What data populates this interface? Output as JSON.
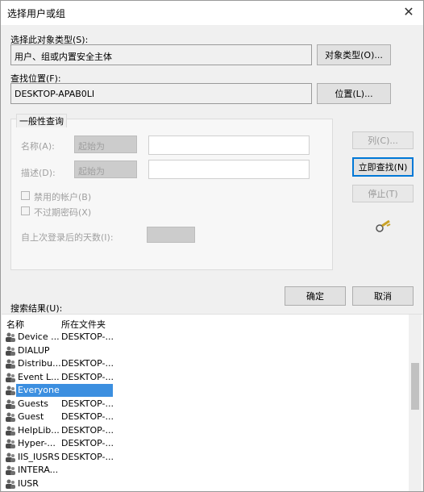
{
  "window": {
    "title": "选择用户或组"
  },
  "object_type": {
    "label": "选择此对象类型(S):",
    "value": "用户、组或内置安全主体",
    "button": "对象类型(O)..."
  },
  "location": {
    "label": "查找位置(F):",
    "value": "DESKTOP-APAB0LI",
    "button": "位置(L)..."
  },
  "general_query": {
    "tab": "一般性查询",
    "name_label": "名称(A):",
    "name_combo": "起始为",
    "desc_label": "描述(D):",
    "desc_combo": "起始为",
    "disabled_accounts": "禁用的帐户(B)",
    "non_expiring_password": "不过期密码(X)",
    "days_since_logon": "自上次登录后的天数(I):"
  },
  "buttons": {
    "columns": "列(C)...",
    "find_now": "立即查找(N)",
    "stop": "停止(T)",
    "ok": "确定",
    "cancel": "取消"
  },
  "results": {
    "label": "搜索结果(U):",
    "col_name": "名称",
    "col_folder": "所在文件夹",
    "rows": [
      {
        "name": "Device ...",
        "folder": "DESKTOP-..."
      },
      {
        "name": "DIALUP",
        "folder": ""
      },
      {
        "name": "Distribu...",
        "folder": "DESKTOP-..."
      },
      {
        "name": "Event L...",
        "folder": "DESKTOP-..."
      },
      {
        "name": "Everyone",
        "folder": ""
      },
      {
        "name": "Guests",
        "folder": "DESKTOP-..."
      },
      {
        "name": "Guest",
        "folder": "DESKTOP-..."
      },
      {
        "name": "HelpLib...",
        "folder": "DESKTOP-..."
      },
      {
        "name": "Hyper-...",
        "folder": "DESKTOP-..."
      },
      {
        "name": "IIS_IUSRS",
        "folder": "DESKTOP-..."
      },
      {
        "name": "INTERA...",
        "folder": ""
      },
      {
        "name": "IUSR",
        "folder": ""
      }
    ],
    "selected_index": 4
  },
  "colors": {
    "accent": "#0078d7",
    "selection": "#3c8fe0"
  }
}
